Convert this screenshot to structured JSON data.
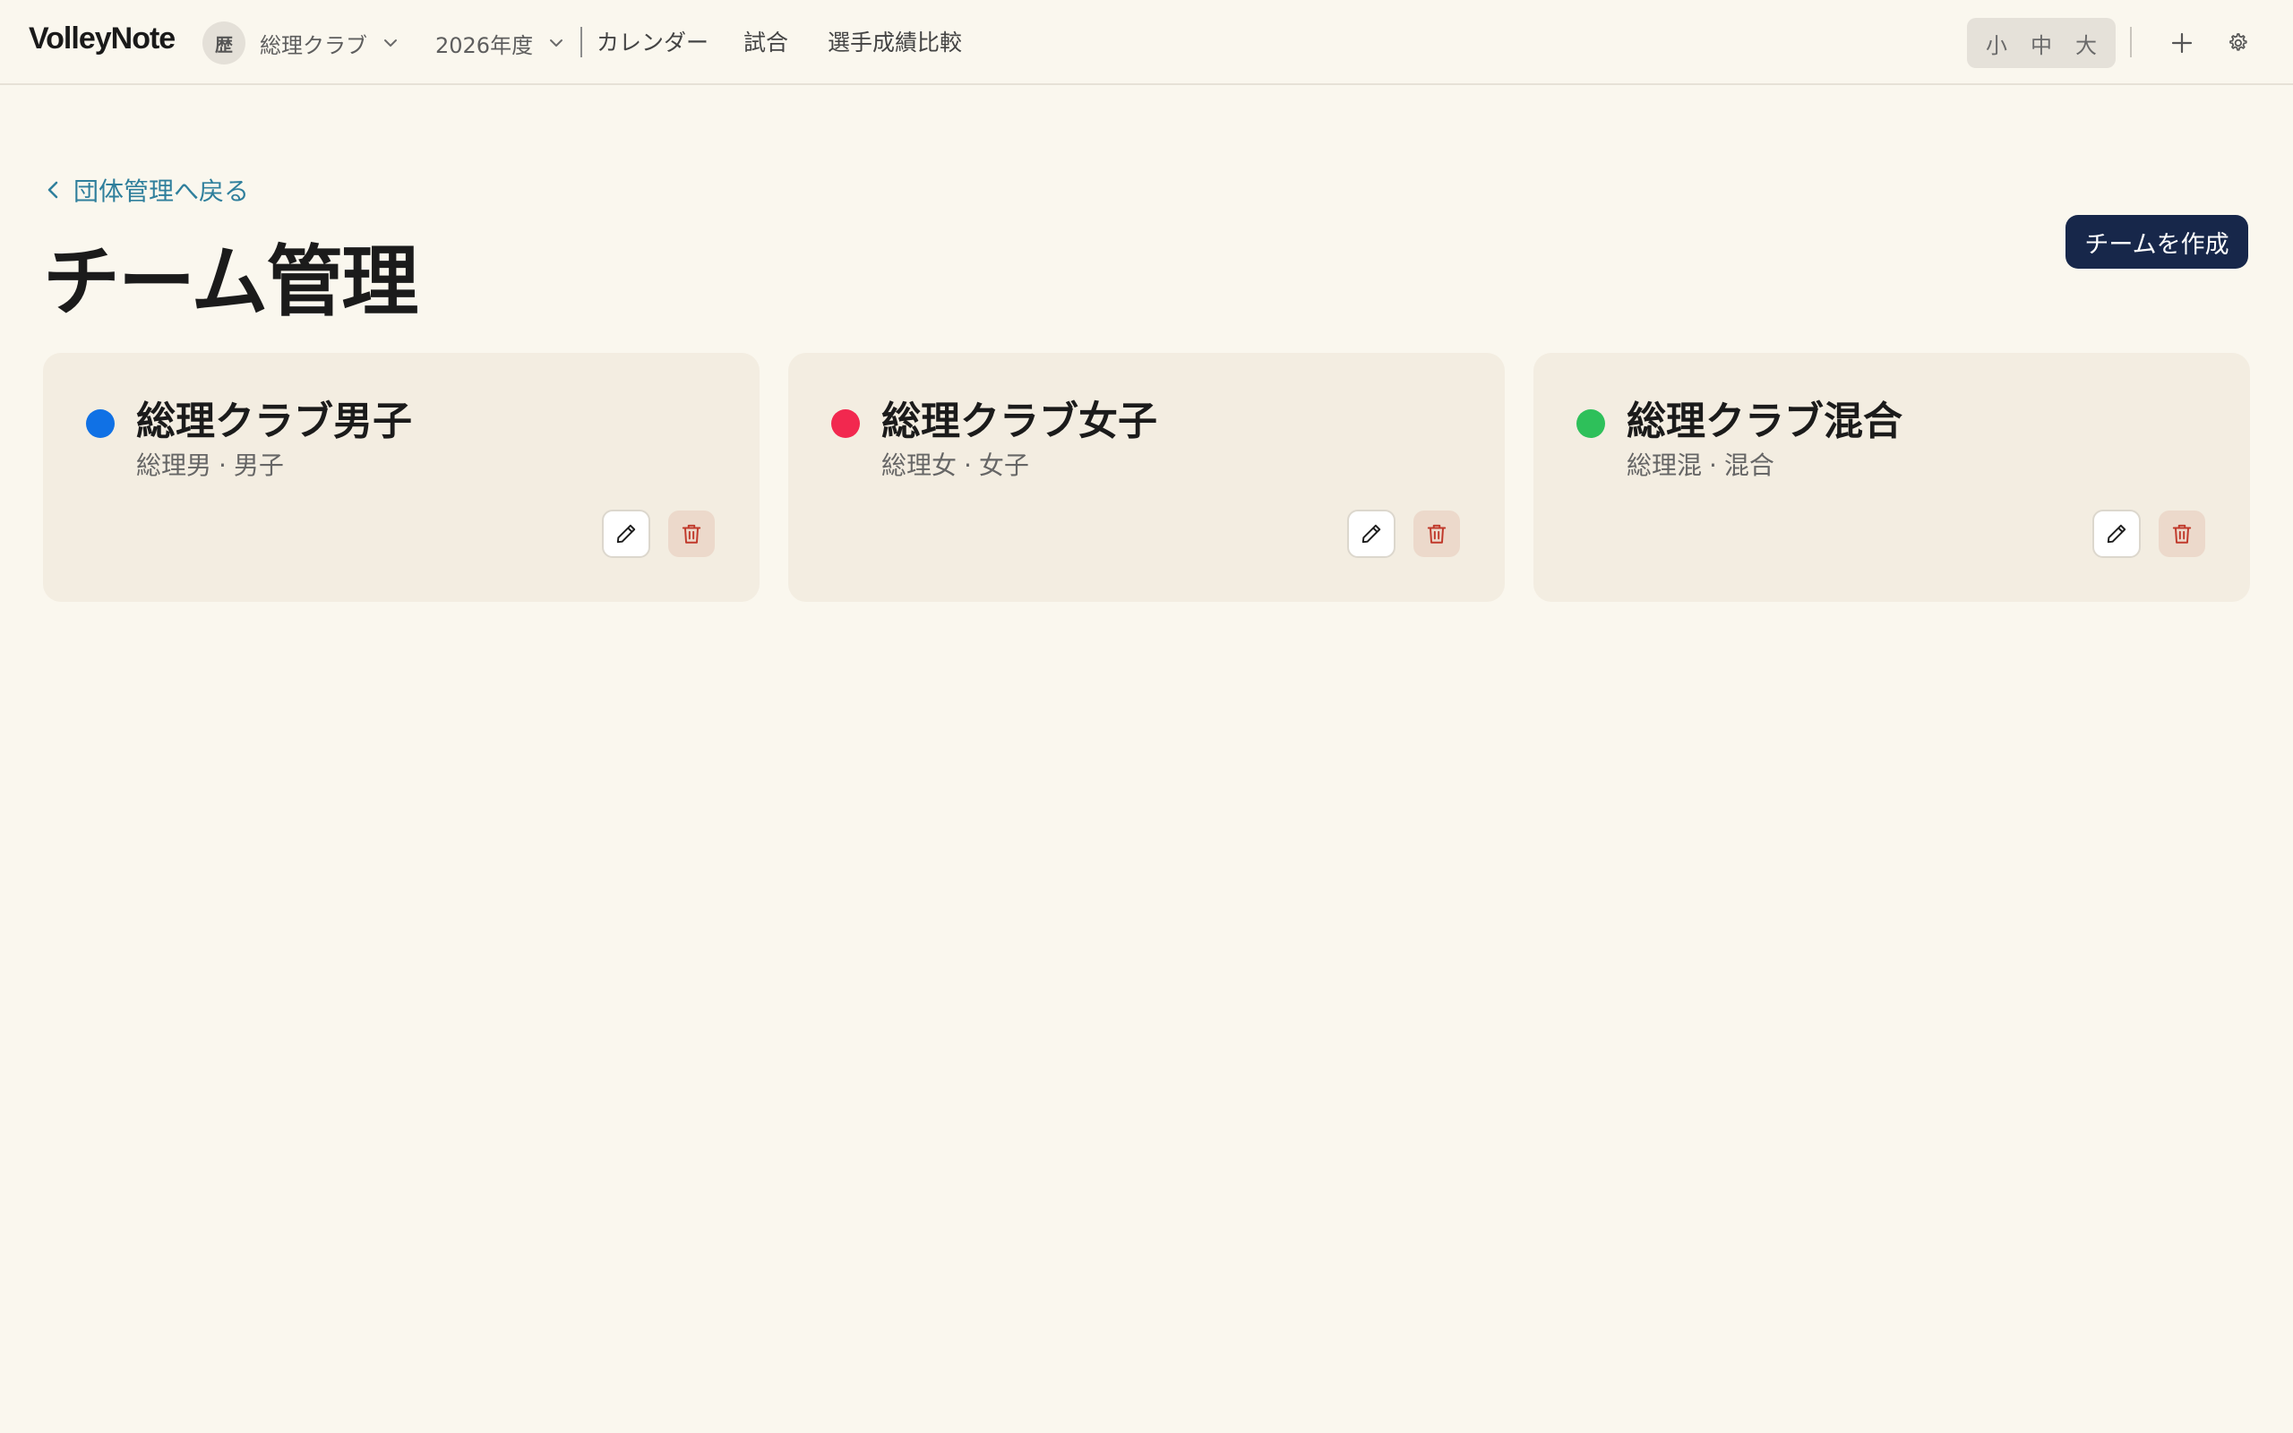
{
  "header": {
    "app_name": "VolleyNote",
    "org": {
      "avatar_char": "歴",
      "name": "総理クラブ"
    },
    "season": {
      "label": "2026年度"
    },
    "nav": [
      {
        "label": "カレンダー"
      },
      {
        "label": "試合"
      },
      {
        "label": "選手成績比較"
      }
    ],
    "font_size": {
      "small": "小",
      "medium": "中",
      "large": "大"
    },
    "icons": {
      "add": "plus-icon",
      "settings": "gear-icon"
    }
  },
  "page": {
    "back_label": "団体管理へ戻る",
    "title": "チーム管理",
    "create_label": "チームを作成"
  },
  "teams": [
    {
      "name": "総理クラブ男子",
      "short": "総理男",
      "category": "男子",
      "color": "#1071e5"
    },
    {
      "name": "総理クラブ女子",
      "short": "総理女",
      "category": "女子",
      "color": "#f2284f"
    },
    {
      "name": "総理クラブ混合",
      "short": "総理混",
      "category": "混合",
      "color": "#2ec05a"
    }
  ],
  "colors": {
    "background": "#faf7ee",
    "card": "#f3ede1",
    "primary_button": "#17274a",
    "link": "#2f7f9c",
    "delete_icon": "#c0392b"
  }
}
